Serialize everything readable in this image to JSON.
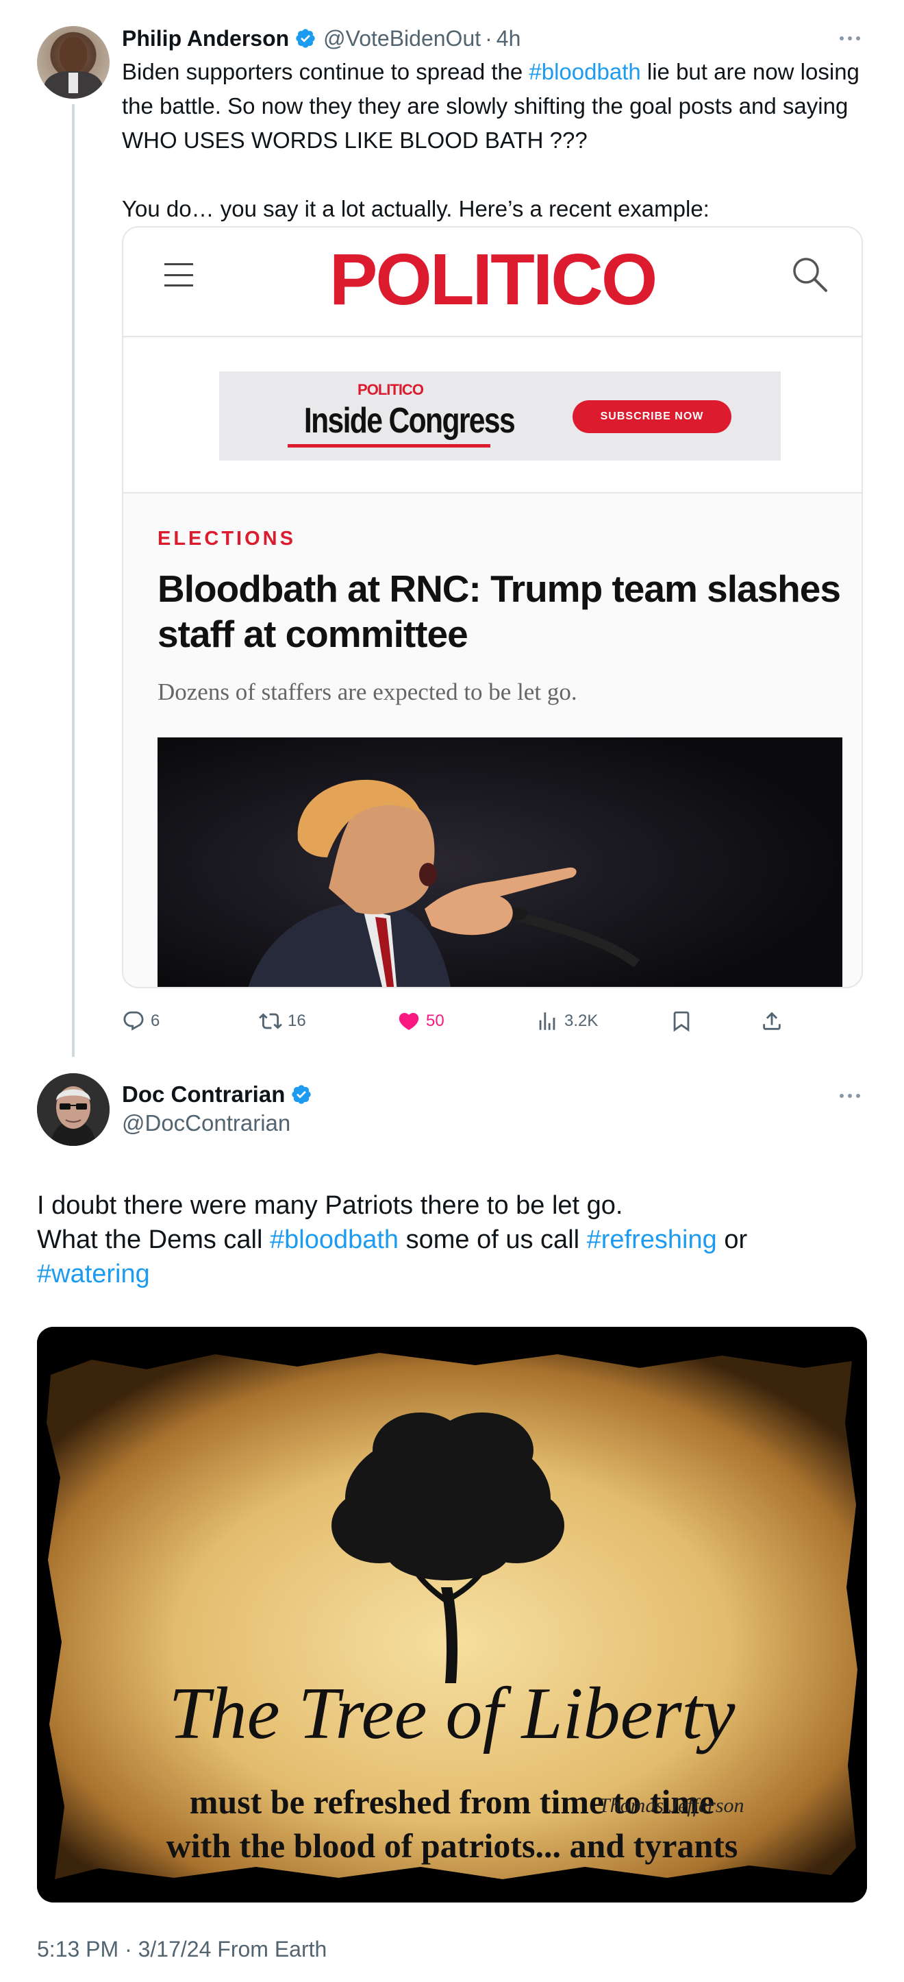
{
  "tweet1": {
    "author_name": "Philip Anderson",
    "handle": "@VoteBidenOut",
    "separator": "·",
    "time": "4h",
    "text_before_hashtag": "Biden supporters continue to spread the ",
    "hashtag": "#bloodbath",
    "text_after_hashtag": " lie but are now losing the battle. So now they they are slowly shifting the goal posts and saying WHO USES WORDS LIKE BLOOD BATH ???",
    "text_para2": "You do… you say it a lot actually. Here’s a recent example:",
    "card": {
      "logo": "POLITICO",
      "ad_small": "POLITICO",
      "ad_title": "Inside Congress",
      "ad_button": "SUBSCRIBE NOW",
      "kicker": "ELECTIONS",
      "headline": "Bloodbath at RNC: Trump team slashes staff at committee",
      "dek": "Dozens of staffers are expected to be let go."
    },
    "stats": {
      "replies": "6",
      "retweets": "16",
      "likes": "50",
      "views": "3.2K"
    },
    "colors": {
      "like": "#f91880",
      "link": "#1d9bf0",
      "politico_red": "#dc1b2f"
    }
  },
  "tweet2": {
    "author_name": "Doc Contrarian",
    "handle": "@DocContrarian",
    "line1": "I doubt there were many Patriots there to be let go.",
    "line2_a": "What the Dems call ",
    "hashtag1": "#bloodbath",
    "line2_b": " some of us call ",
    "hashtag2": "#refreshing",
    "line2_c": " or",
    "hashtag3": "#watering",
    "image": {
      "title": "The Tree of Liberty",
      "line1": "must be refreshed from time to time",
      "line2": "with the blood of patriots... and tyrants",
      "signature": "Thomas Jefferson"
    },
    "timestamp": "5:13 PM · 3/17/24 From Earth"
  }
}
